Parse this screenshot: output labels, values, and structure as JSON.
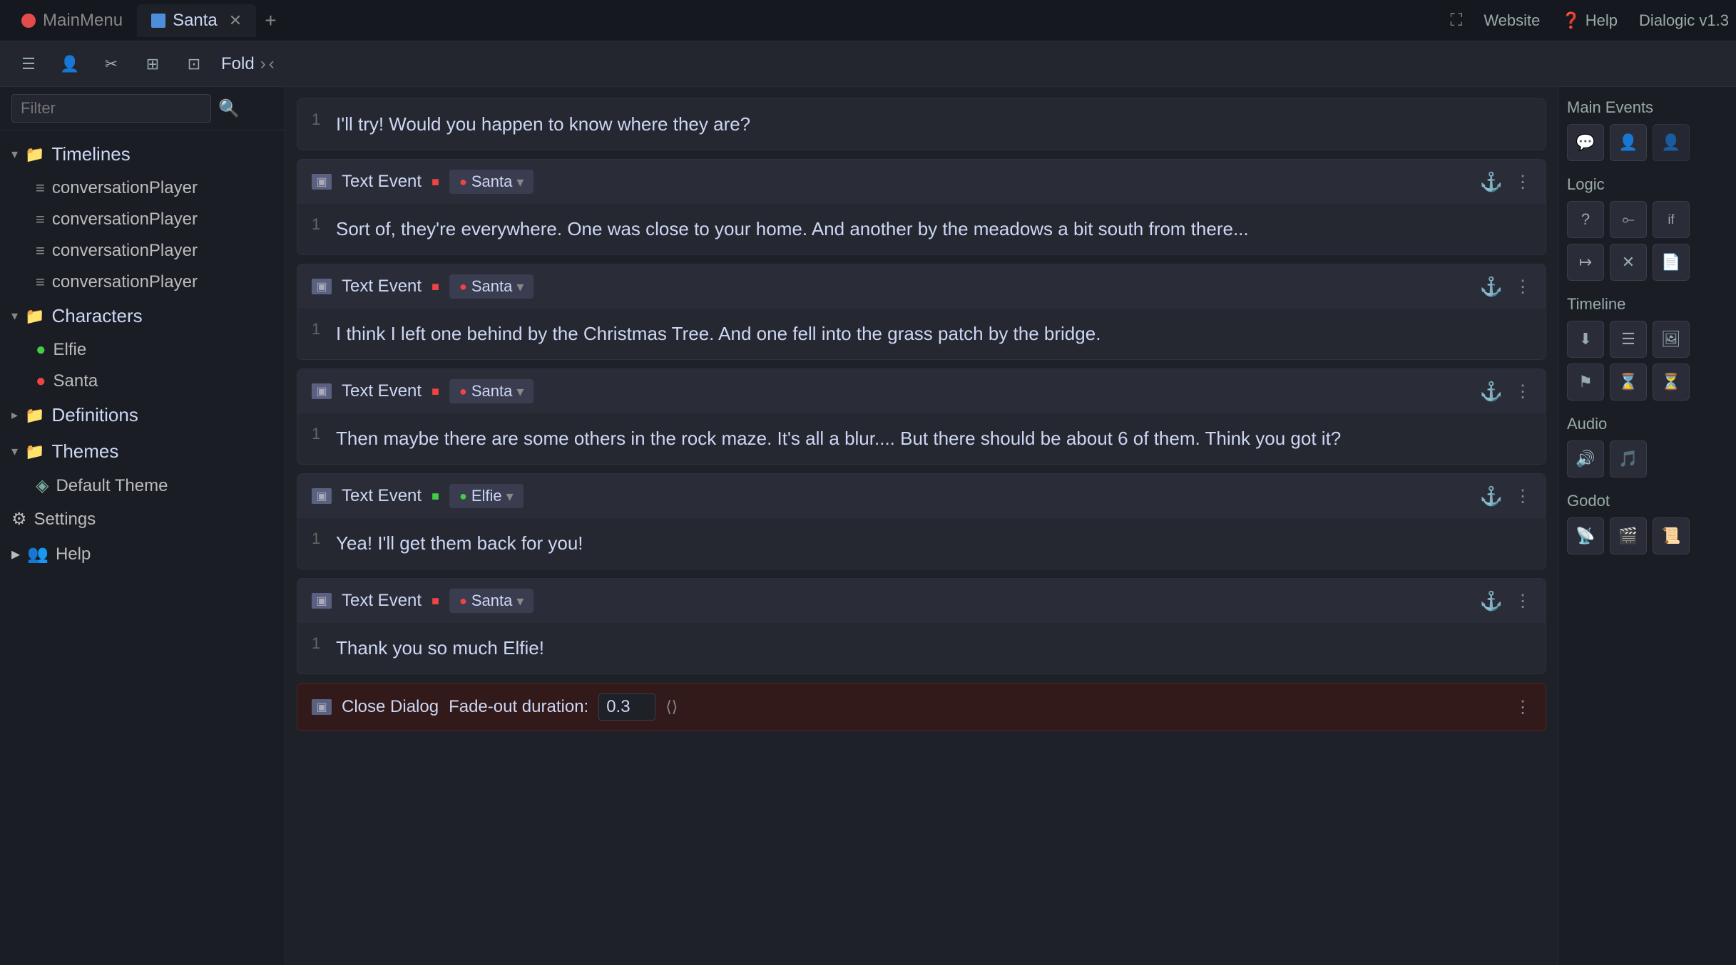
{
  "titleBar": {
    "tabs": [
      {
        "id": "mainmenu",
        "label": "MainMenu",
        "icon": "main",
        "active": false
      },
      {
        "id": "santa",
        "label": "Santa",
        "icon": "dialog",
        "active": true
      }
    ],
    "plusLabel": "+",
    "website": "Website",
    "help": "Help",
    "version": "Dialogic v1.3"
  },
  "toolbar": {
    "buttons": [
      "≡",
      "👤",
      "✂",
      "⊞",
      "⊡"
    ],
    "foldLabel": "Fold",
    "arrowRight": "›",
    "arrowDown": "‹"
  },
  "sidebar": {
    "filterPlaceholder": "Filter",
    "sections": [
      {
        "id": "timelines",
        "label": "Timelines",
        "icon": "📁",
        "open": true,
        "items": [
          {
            "id": "cp1",
            "label": "conversationPlayer",
            "icon": "lines"
          },
          {
            "id": "cp2",
            "label": "conversationPlayer",
            "icon": "lines"
          },
          {
            "id": "cp3",
            "label": "conversationPlayer",
            "icon": "lines"
          },
          {
            "id": "cp4",
            "label": "conversationPlayer",
            "icon": "lines"
          }
        ]
      },
      {
        "id": "characters",
        "label": "Characters",
        "icon": "📁",
        "open": true,
        "items": [
          {
            "id": "elfie",
            "label": "Elfie",
            "icon": "green-dot"
          },
          {
            "id": "santa",
            "label": "Santa",
            "icon": "red-dot"
          }
        ]
      },
      {
        "id": "definitions",
        "label": "Definitions",
        "icon": "📁",
        "open": false,
        "items": []
      },
      {
        "id": "themes",
        "label": "Themes",
        "icon": "📁",
        "open": true,
        "items": [
          {
            "id": "defaulttheme",
            "label": "Default Theme",
            "icon": "theme"
          }
        ]
      }
    ],
    "settings": "Settings",
    "help": "Help"
  },
  "events": [
    {
      "id": "partial-top",
      "type": "partial",
      "text": "I'll try! Would you happen to know where they are?"
    },
    {
      "id": "event1",
      "type": "Text Event",
      "character": "Santa",
      "charColor": "red",
      "lineNum": "1",
      "text": "Sort of, they're everywhere. One was close to your home. And another by the meadows a bit south from there..."
    },
    {
      "id": "event2",
      "type": "Text Event",
      "character": "Santa",
      "charColor": "red",
      "lineNum": "1",
      "text": "I think I left one behind by the Christmas Tree. And one fell into the grass patch by the bridge."
    },
    {
      "id": "event3",
      "type": "Text Event",
      "character": "Santa",
      "charColor": "red",
      "lineNum": "1",
      "text": "Then maybe there are some others in the rock maze. It's all a blur.... But there should be about 6 of them. Think you got it?"
    },
    {
      "id": "event4",
      "type": "Text Event",
      "character": "Elfie",
      "charColor": "green",
      "lineNum": "1",
      "text": "Yea! I'll get them back for you!"
    },
    {
      "id": "event5",
      "type": "Text Event",
      "character": "Santa",
      "charColor": "red",
      "lineNum": "1",
      "text": "Thank you so much Elfie!"
    },
    {
      "id": "closedialog",
      "type": "Close Dialog",
      "fadeLabel": "Fade-out duration:",
      "fadeValue": "0.3"
    }
  ],
  "rightPanel": {
    "sections": [
      {
        "id": "main-events",
        "title": "Main Events",
        "icons": [
          {
            "id": "dialog-icon",
            "symbol": "💬"
          },
          {
            "id": "add-character-icon",
            "symbol": "👤"
          },
          {
            "id": "remove-character-icon",
            "symbol": "👤"
          }
        ]
      },
      {
        "id": "logic",
        "title": "Logic",
        "icons": [
          {
            "id": "question-icon",
            "symbol": "?"
          },
          {
            "id": "branch-icon",
            "symbol": "⟜"
          },
          {
            "id": "if-icon",
            "symbol": "if"
          },
          {
            "id": "goto-icon",
            "symbol": "↦"
          },
          {
            "id": "close-icon",
            "symbol": "✕"
          },
          {
            "id": "doc-icon",
            "symbol": "📄"
          }
        ]
      },
      {
        "id": "timeline",
        "title": "Timeline",
        "icons": [
          {
            "id": "dl-icon",
            "symbol": "⬇"
          },
          {
            "id": "list-icon",
            "symbol": "☰"
          },
          {
            "id": "img-icon",
            "symbol": "🖼"
          },
          {
            "id": "flag-icon",
            "symbol": "⚑"
          },
          {
            "id": "timer-icon",
            "symbol": "⌛"
          },
          {
            "id": "wait-icon",
            "symbol": "⏳"
          }
        ]
      },
      {
        "id": "audio",
        "title": "Audio",
        "icons": [
          {
            "id": "sound-icon",
            "symbol": "🔊"
          },
          {
            "id": "music-icon",
            "symbol": "🎵"
          }
        ]
      },
      {
        "id": "godot",
        "title": "Godot",
        "icons": [
          {
            "id": "rss-icon",
            "symbol": "📡"
          },
          {
            "id": "scene-icon",
            "symbol": "🎬"
          },
          {
            "id": "script-icon",
            "symbol": "📜"
          }
        ]
      }
    ]
  }
}
